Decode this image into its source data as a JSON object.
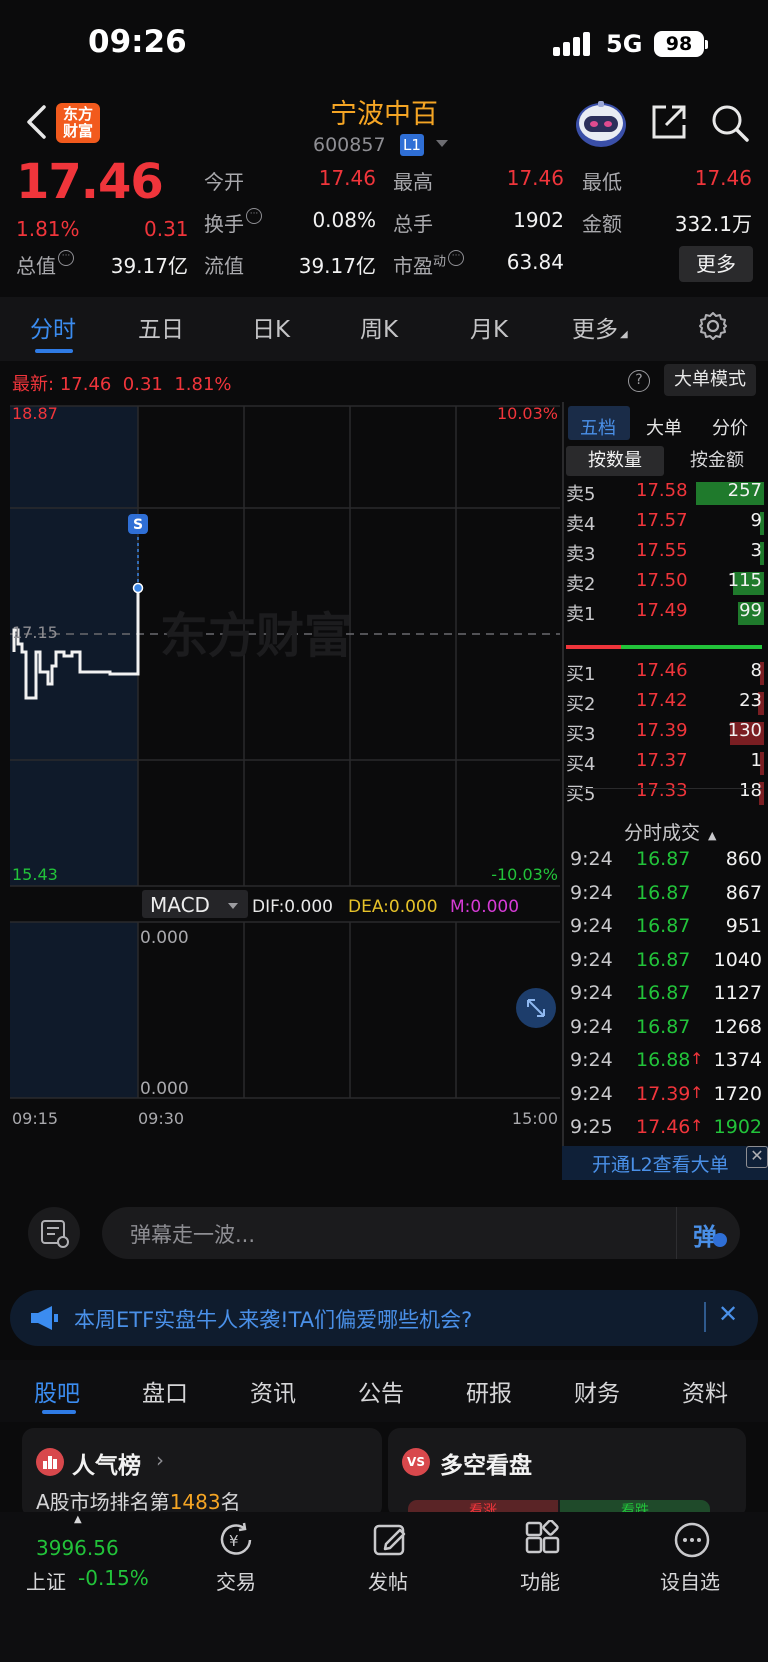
{
  "status": {
    "time": "09:26",
    "network": "5G",
    "battery": "98"
  },
  "header": {
    "title": "宁波中百",
    "code": "600857",
    "level": "L1",
    "logo_text_line1": "东方",
    "logo_text_line2": "财富"
  },
  "quote": {
    "price": "17.46",
    "change_pct": "1.81%",
    "change": "0.31",
    "stats": [
      {
        "label": "今开",
        "value": "17.46",
        "color": "red"
      },
      {
        "label": "最高",
        "value": "17.46",
        "color": "red"
      },
      {
        "label": "最低",
        "value": "17.46",
        "color": "red"
      },
      {
        "label": "换手",
        "value": "0.08%",
        "color": "white"
      },
      {
        "label": "总手",
        "value": "1902",
        "color": "white"
      },
      {
        "label": "金额",
        "value": "332.1万",
        "color": "white"
      },
      {
        "label": "总值",
        "value": "39.17亿",
        "color": "white"
      },
      {
        "label": "流值",
        "value": "39.17亿",
        "color": "white"
      },
      {
        "label": "市盈",
        "label_sup": "动",
        "value": "63.84",
        "color": "white"
      }
    ],
    "more_label": "更多"
  },
  "tabs": [
    "分时",
    "五日",
    "日K",
    "周K",
    "月K",
    "更多"
  ],
  "latest_line": {
    "label": "最新:",
    "price": "17.46",
    "change": "0.31",
    "pct": "1.81%"
  },
  "big_order_mode": "大单模式",
  "chart": {
    "y_max": "18.87",
    "y_mid": "17.15",
    "y_min": "15.43",
    "pct_max": "10.03%",
    "pct_min": "-10.03%",
    "watermark": "东方财富",
    "marker": "S",
    "x_labels": [
      "09:15",
      "09:30",
      "15:00"
    ],
    "macd": {
      "label": "MACD",
      "dif": "DIF:0.000",
      "dea": "DEA:0.000",
      "m": "M:0.000",
      "top": "0.000",
      "bottom": "0.000"
    },
    "colors": {
      "up": "#f0353b",
      "down": "#22c33a",
      "dif": "#e8e8e8",
      "dea": "#e6c229",
      "m": "#d63bd6"
    }
  },
  "panel": {
    "tabs": [
      "五档",
      "大单",
      "分价"
    ],
    "sub_tabs": [
      "按数量",
      "按金额"
    ],
    "sells": [
      {
        "label": "卖5",
        "price": "17.58",
        "vol": "257",
        "bar": 1.0
      },
      {
        "label": "卖4",
        "price": "17.57",
        "vol": "9",
        "bar": 0.04
      },
      {
        "label": "卖3",
        "price": "17.55",
        "vol": "3",
        "bar": 0.02
      },
      {
        "label": "卖2",
        "price": "17.50",
        "vol": "115",
        "bar": 0.45
      },
      {
        "label": "卖1",
        "price": "17.49",
        "vol": "99",
        "bar": 0.38
      }
    ],
    "buys": [
      {
        "label": "买1",
        "price": "17.46",
        "vol": "8",
        "bar": 0.04
      },
      {
        "label": "买2",
        "price": "17.42",
        "vol": "23",
        "bar": 0.09
      },
      {
        "label": "买3",
        "price": "17.39",
        "vol": "130",
        "bar": 0.5
      },
      {
        "label": "买4",
        "price": "17.37",
        "vol": "1",
        "bar": 0.02
      },
      {
        "label": "买5",
        "price": "17.33",
        "vol": "18",
        "bar": 0.07
      }
    ],
    "ticks_title": "分时成交",
    "ticks": [
      {
        "time": "9:24",
        "price": "16.87",
        "vol": "860",
        "dir": "down",
        "arrow": ""
      },
      {
        "time": "9:24",
        "price": "16.87",
        "vol": "867",
        "dir": "down",
        "arrow": ""
      },
      {
        "time": "9:24",
        "price": "16.87",
        "vol": "951",
        "dir": "down",
        "arrow": ""
      },
      {
        "time": "9:24",
        "price": "16.87",
        "vol": "1040",
        "dir": "down",
        "arrow": ""
      },
      {
        "time": "9:24",
        "price": "16.87",
        "vol": "1127",
        "dir": "down",
        "arrow": ""
      },
      {
        "time": "9:24",
        "price": "16.87",
        "vol": "1268",
        "dir": "down",
        "arrow": ""
      },
      {
        "time": "9:24",
        "price": "16.88",
        "vol": "1374",
        "dir": "down",
        "arrow": "↑"
      },
      {
        "time": "9:24",
        "price": "17.39",
        "vol": "1720",
        "dir": "up",
        "arrow": "↑"
      },
      {
        "time": "9:25",
        "price": "17.46",
        "vol": "1902",
        "dir": "up",
        "arrow": "↑"
      }
    ],
    "l2_promo": "开通L2查看大单"
  },
  "danmaku": {
    "placeholder": "弹幕走一波...",
    "send_label": "弹"
  },
  "banner": {
    "text": "本周ETF实盘牛人来袭!TA们偏爱哪些机会?"
  },
  "bottom_tabs": [
    "股吧",
    "盘口",
    "资讯",
    "公告",
    "研报",
    "财务",
    "资料"
  ],
  "cards": {
    "left_title": "人气榜",
    "left_subtitle_prefix": "A股市场排名第",
    "left_rank": "1483",
    "left_subtitle_suffix": "名",
    "right_title": "多空看盘",
    "right_badge": "VS",
    "right_pill_up": "看涨",
    "right_pill_down": "看跌"
  },
  "nav": {
    "index_value": "3996.56",
    "index_name": "上证",
    "index_change": "-0.15%",
    "items": [
      "交易",
      "发帖",
      "功能",
      "设自选"
    ]
  }
}
